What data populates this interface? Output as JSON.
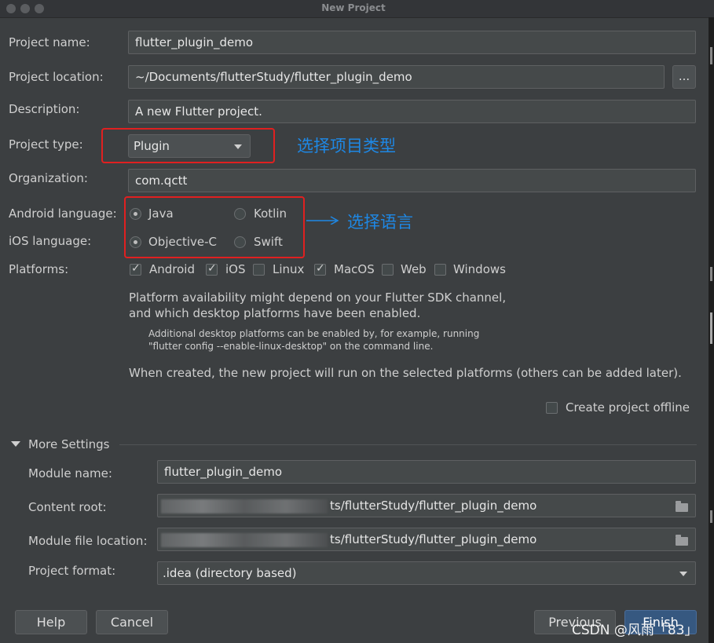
{
  "window": {
    "title": "New Project"
  },
  "form": {
    "project_name": {
      "label": "Project name:",
      "value": "flutter_plugin_demo"
    },
    "project_location": {
      "label": "Project location:",
      "value": "~/Documents/flutterStudy/flutter_plugin_demo",
      "browse_label": "..."
    },
    "description": {
      "label": "Description:",
      "value": "A new Flutter project."
    },
    "project_type": {
      "label": "Project type:",
      "value": "Plugin"
    },
    "organization": {
      "label": "Organization:",
      "value": "com.qctt"
    },
    "android_language": {
      "label": "Android language:",
      "options": [
        "Java",
        "Kotlin"
      ],
      "selected": "Java"
    },
    "ios_language": {
      "label": "iOS language:",
      "options": [
        "Objective-C",
        "Swift"
      ],
      "selected": "Objective-C"
    },
    "platforms": {
      "label": "Platforms:",
      "items": [
        {
          "name": "Android",
          "checked": true
        },
        {
          "name": "iOS",
          "checked": true
        },
        {
          "name": "Linux",
          "checked": false
        },
        {
          "name": "MacOS",
          "checked": true
        },
        {
          "name": "Web",
          "checked": false
        },
        {
          "name": "Windows",
          "checked": false
        }
      ]
    },
    "availability_line1": "Platform availability might depend on your Flutter SDK channel,",
    "availability_line2": "and which desktop platforms have been enabled.",
    "additional_line1": "Additional desktop platforms can be enabled by, for example, running",
    "additional_line2": "\"flutter config --enable-linux-desktop\" on the command line.",
    "when_created": "When created, the new project will run on the selected platforms (others can be added later).",
    "create_offline": {
      "label": "Create project offline",
      "checked": false
    }
  },
  "more_settings": {
    "title": "More Settings",
    "module_name": {
      "label": "Module name:",
      "value": "flutter_plugin_demo"
    },
    "content_root": {
      "label": "Content root:",
      "value": "ts/flutterStudy/flutter_plugin_demo"
    },
    "module_file_location": {
      "label": "Module file location:",
      "value": "ts/flutterStudy/flutter_plugin_demo"
    },
    "project_format": {
      "label": "Project format:",
      "value": ".idea (directory based)"
    }
  },
  "annotations": {
    "project_type_note": "选择项目类型",
    "language_note": "选择语言",
    "annotation_color": "#1e88e5",
    "highlight_color": "#e02020"
  },
  "footer": {
    "help": "Help",
    "cancel": "Cancel",
    "previous": "Previous",
    "finish": "Finish",
    "watermark": "CSDN @风雨「83」"
  }
}
